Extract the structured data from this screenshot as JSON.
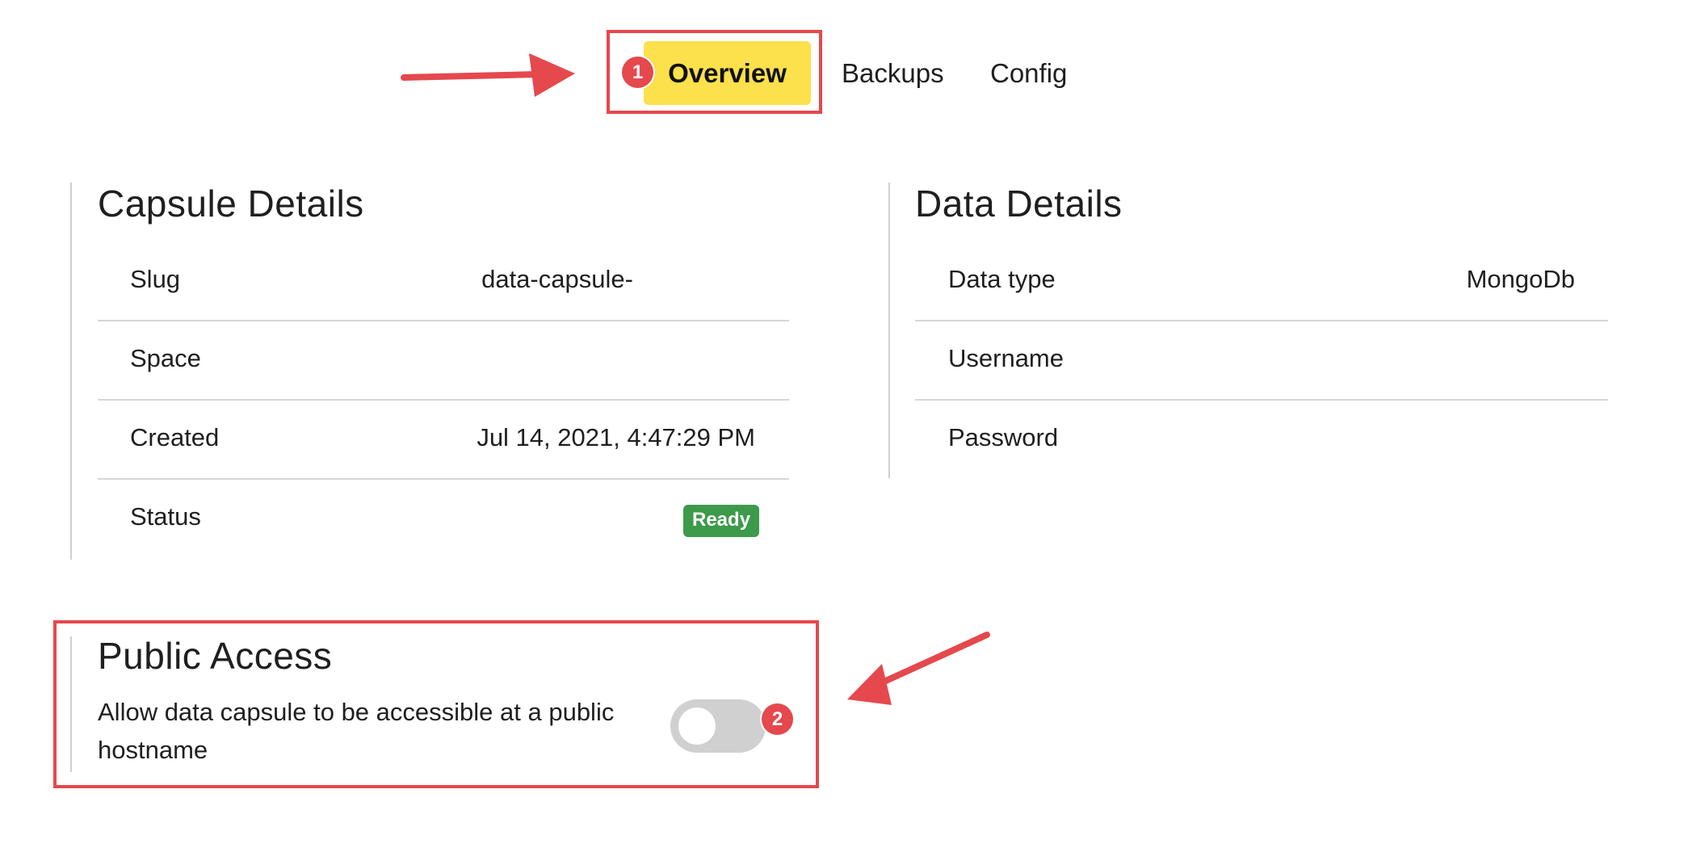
{
  "tabs": [
    {
      "label": "Overview",
      "active": true
    },
    {
      "label": "Backups",
      "active": false
    },
    {
      "label": "Config",
      "active": false
    }
  ],
  "annotations": {
    "marker1": "1",
    "marker2": "2",
    "highlight_color": "#e5484d"
  },
  "capsule_details": {
    "title": "Capsule Details",
    "rows": [
      {
        "label": "Slug",
        "value": "data-capsule-"
      },
      {
        "label": "Space",
        "value": ""
      },
      {
        "label": "Created",
        "value": "Jul 14, 2021, 4:47:29 PM"
      },
      {
        "label": "Status",
        "value": "Ready"
      }
    ]
  },
  "data_details": {
    "title": "Data Details",
    "rows": [
      {
        "label": "Data type",
        "value": "MongoDb"
      },
      {
        "label": "Username",
        "value": ""
      },
      {
        "label": "Password",
        "value": ""
      }
    ]
  },
  "public_access": {
    "title": "Public Access",
    "description_line1": "Allow data capsule to be accessible at a public",
    "description_line2": "hostname",
    "enabled": false
  },
  "colors": {
    "tab_active_bg": "#fce04c",
    "status_ready": "#3d9a4a",
    "toggle_off": "#d0d0d0"
  }
}
